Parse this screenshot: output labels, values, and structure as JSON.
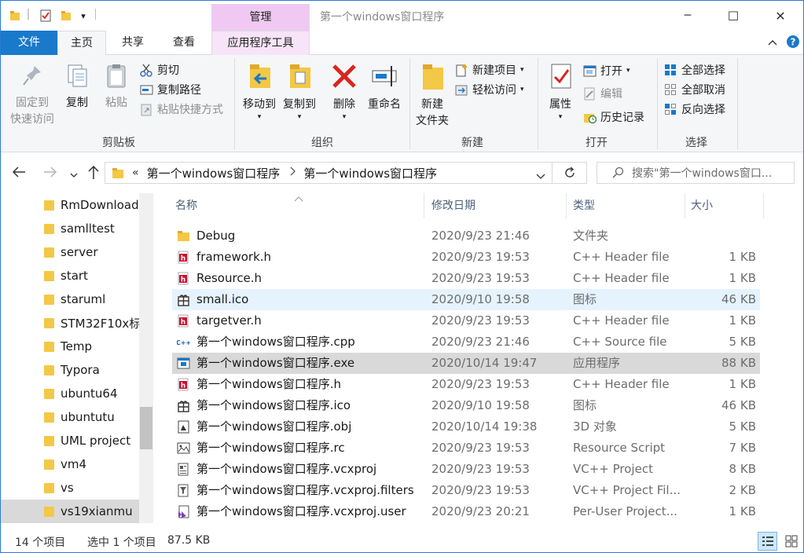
{
  "window": {
    "title": "第一个windows窗口程序",
    "contextual_tab": "管理",
    "controls": {
      "minimize": "─",
      "maximize": "☐",
      "close": "✕"
    }
  },
  "quick_access": {
    "dropdown": "▾"
  },
  "tabs": [
    "文件",
    "主页",
    "共享",
    "查看",
    "应用程序工具"
  ],
  "ribbon": {
    "groups": {
      "clipboard": "剪贴板",
      "organize": "组织",
      "new": "新建",
      "open": "打开",
      "select": "选择"
    },
    "pin": [
      "固定到",
      "快速访问"
    ],
    "copy": "复制",
    "paste": "粘贴",
    "cut": "剪切",
    "copy_path": "复制路径",
    "paste_shortcut": "粘贴快捷方式",
    "move_to": "移动到",
    "copy_to": "复制到",
    "delete": "删除",
    "rename": "重命名",
    "new_folder": [
      "新建",
      "文件夹"
    ],
    "new_item": "新建项目",
    "easy_access": "轻松访问",
    "properties": "属性",
    "open": "打开",
    "edit": "编辑",
    "history": "历史记录",
    "select_all": "全部选择",
    "select_none": "全部取消",
    "invert_selection": "反向选择"
  },
  "address": {
    "chevron": "«",
    "crumbs": [
      "第一个windows窗口程序",
      "第一个windows窗口程序"
    ],
    "search_placeholder": "搜索\"第一个windows窗口..."
  },
  "sidebar": {
    "items": [
      "RmDownload",
      "samlltest",
      "server",
      "start",
      "staruml",
      "STM32F10x标",
      "Temp",
      "Typora",
      "ubuntu64",
      "ubuntutu",
      "UML project",
      "vm4",
      "vs",
      "vs19xianmu"
    ]
  },
  "columns": {
    "name": "名称",
    "date": "修改日期",
    "type": "类型",
    "size": "大小"
  },
  "files": [
    {
      "name": "Debug",
      "date": "2020/9/23 21:46",
      "type": "文件夹",
      "size": "",
      "icon": "folder-icon"
    },
    {
      "name": "framework.h",
      "date": "2020/9/23 19:53",
      "type": "C++ Header file",
      "size": "1 KB",
      "icon": "header-file-icon"
    },
    {
      "name": "Resource.h",
      "date": "2020/9/23 19:53",
      "type": "C++ Header file",
      "size": "1 KB",
      "icon": "header-file-icon"
    },
    {
      "name": "small.ico",
      "date": "2020/9/10 19:58",
      "type": "图标",
      "size": "46 KB",
      "icon": "ico-file-icon"
    },
    {
      "name": "targetver.h",
      "date": "2020/9/23 19:53",
      "type": "C++ Header file",
      "size": "1 KB",
      "icon": "header-file-icon"
    },
    {
      "name": "第一个windows窗口程序.cpp",
      "date": "2020/9/23 21:46",
      "type": "C++ Source file",
      "size": "5 KB",
      "icon": "cpp-file-icon"
    },
    {
      "name": "第一个windows窗口程序.exe",
      "date": "2020/10/14 19:47",
      "type": "应用程序",
      "size": "88 KB",
      "icon": "exe-file-icon"
    },
    {
      "name": "第一个windows窗口程序.h",
      "date": "2020/9/23 19:53",
      "type": "C++ Header file",
      "size": "1 KB",
      "icon": "header-file-icon"
    },
    {
      "name": "第一个windows窗口程序.ico",
      "date": "2020/9/10 19:58",
      "type": "图标",
      "size": "46 KB",
      "icon": "ico-file-icon"
    },
    {
      "name": "第一个windows窗口程序.obj",
      "date": "2020/10/14 19:38",
      "type": "3D 对象",
      "size": "5 KB",
      "icon": "obj-file-icon"
    },
    {
      "name": "第一个windows窗口程序.rc",
      "date": "2020/9/23 19:53",
      "type": "Resource Script",
      "size": "7 KB",
      "icon": "rc-file-icon"
    },
    {
      "name": "第一个windows窗口程序.vcxproj",
      "date": "2020/9/23 19:53",
      "type": "VC++ Project",
      "size": "8 KB",
      "icon": "vcxproj-file-icon"
    },
    {
      "name": "第一个windows窗口程序.vcxproj.filters",
      "date": "2020/9/23 19:53",
      "type": "VC++ Project Fil...",
      "size": "2 KB",
      "icon": "filters-file-icon"
    },
    {
      "name": "第一个windows窗口程序.vcxproj.user",
      "date": "2020/9/23 20:21",
      "type": "Per-User Project...",
      "size": "1 KB",
      "icon": "user-file-icon"
    }
  ],
  "status": {
    "count": "14 个项目",
    "selected": "选中 1 个项目",
    "size": "87.5 KB"
  },
  "colors": {
    "accent": "#1979ca",
    "manage_tab": "#f0c9f2",
    "folder": "#f3c846",
    "hover_row": "#e5f3ff",
    "selected_row": "#d9d9d9"
  }
}
